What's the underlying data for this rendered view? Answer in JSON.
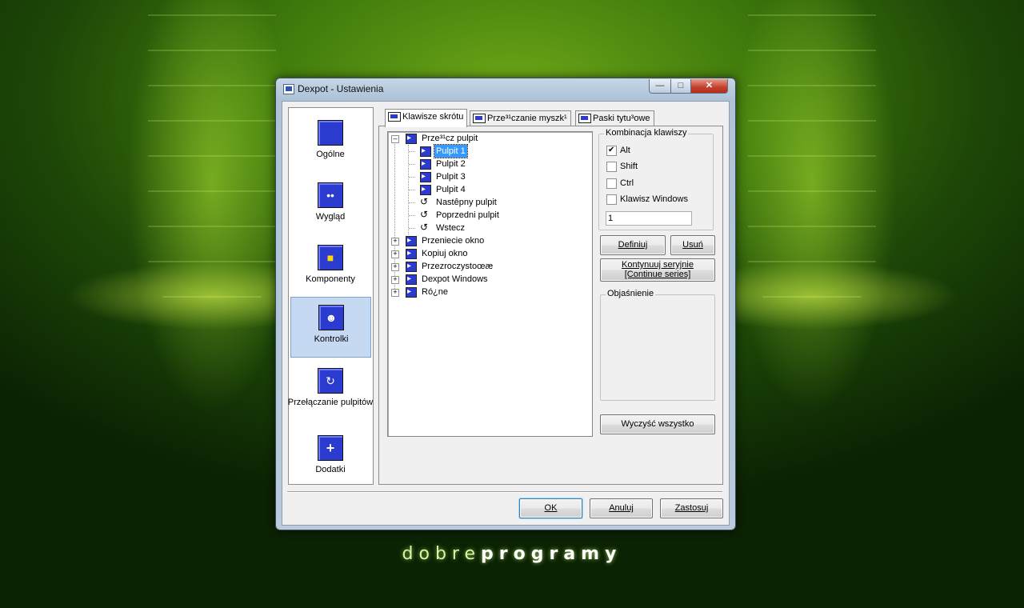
{
  "window": {
    "title": "Dexpot - Ustawienia"
  },
  "categories": [
    {
      "label": "Ogólne",
      "icon": "monitor-icon"
    },
    {
      "label": "Wygląd",
      "icon": "eyes-icon"
    },
    {
      "label": "Komponenty",
      "icon": "components-icon"
    },
    {
      "label": "Kontrolki",
      "icon": "controls-icon"
    },
    {
      "label": "Przełączanie pulpitów",
      "icon": "switch-icon"
    },
    {
      "label": "Dodatki",
      "icon": "plus-icon"
    }
  ],
  "selected_category": "Kontrolki",
  "tabs": [
    {
      "label": "Klawisze skrótu",
      "icon": "keyboard-icon"
    },
    {
      "label": "Prze³¹czanie myszk¹",
      "icon": "mouse-icon"
    },
    {
      "label": "Paski tytu³owe",
      "icon": "titlebar-icon"
    }
  ],
  "tree": {
    "root": "Prze³¹cz pulpit",
    "children": [
      "Pulpit 1",
      "Pulpit 2",
      "Pulpit 3",
      "Pulpit 4",
      "Nastêpny pulpit",
      "Poprzedni pulpit",
      "Wstecz"
    ],
    "selected": "Pulpit 1",
    "collapsed": [
      "Przeniecie okno",
      "Kopiuj okno",
      "Przezroczystoœæ",
      "Dexpot Windows",
      "Ró¿ne"
    ]
  },
  "combo_group": {
    "legend": "Kombinacja klawiszy",
    "checkboxes": [
      {
        "label": "Alt",
        "checked": true
      },
      {
        "label": "Shift",
        "checked": false
      },
      {
        "label": "Ctrl",
        "checked": false
      },
      {
        "label": "Klawisz Windows",
        "checked": false
      }
    ],
    "value": "1"
  },
  "buttons": {
    "define": "Definiuj",
    "remove": "Usuń",
    "continue_line1": "Kontynuuj seryjnie",
    "continue_line2": "[Continue series]",
    "clear_all": "Wyczyść wszystko",
    "ok": "OK",
    "cancel": "Anuluj",
    "apply": "Zastosuj"
  },
  "explanation": {
    "legend": "Objaśnienie",
    "text": ""
  },
  "brand": {
    "light": "dobre",
    "bold": "programy"
  },
  "colors": {
    "selection": "#3399ff",
    "category_selected": "#c6d9f2",
    "icon_blue": "#2b3bcf"
  }
}
